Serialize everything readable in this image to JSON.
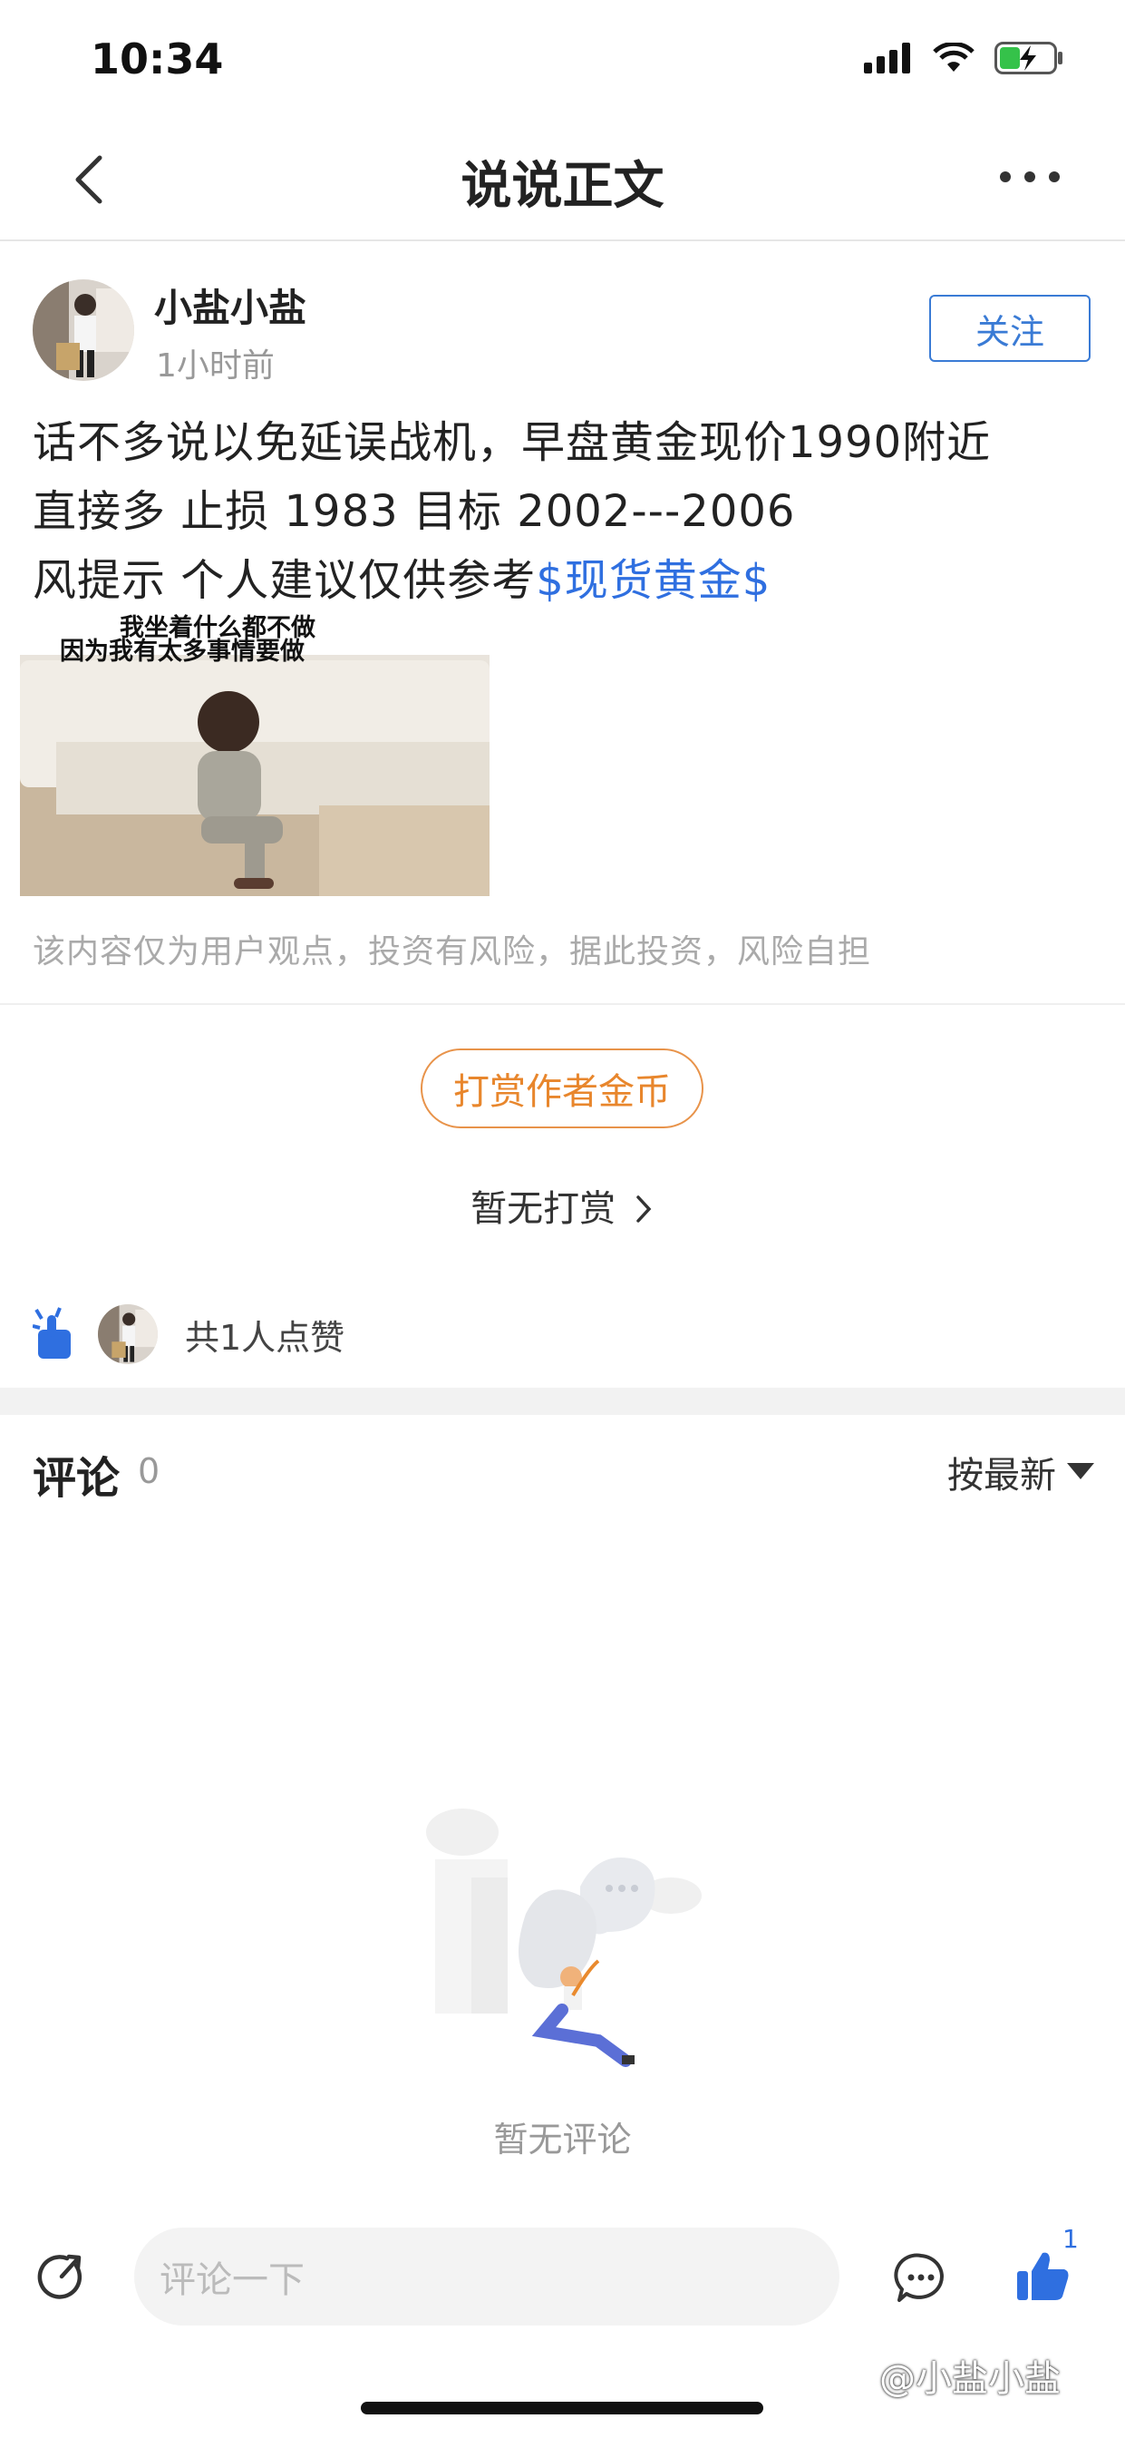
{
  "status": {
    "time": "10:34"
  },
  "nav": {
    "title": "说说正文",
    "back_icon": "chevron-left-icon",
    "more_icon": "more-dots-icon"
  },
  "author": {
    "name": "小盐小盐",
    "time": "1小时前",
    "follow_label": "关注"
  },
  "post": {
    "line1": "话不多说以免延误战机，早盘黄金现价1990附近",
    "line2": "直接多 止损 1983 目标 2002---2006",
    "line3_prefix": "风提示 个人建议仅供参考",
    "tag": "$现货黄金$",
    "image_caption_1": "我坐着什么都不做",
    "image_caption_2": "因为我有太多事情要做"
  },
  "disclaimer": "该内容仅为用户观点，投资有风险，据此投资，风险自担",
  "reward": {
    "button_label": "打赏作者金币",
    "info": "暂无打赏"
  },
  "likes": {
    "text": "共1人点赞"
  },
  "comments": {
    "title": "评论",
    "count": "0",
    "sort_label": "按最新",
    "empty_text": "暂无评论"
  },
  "bottom_bar": {
    "input_placeholder": "评论一下",
    "like_count": "1"
  },
  "watermark": "@小盐小盐",
  "colors": {
    "accent": "#2f6fe0",
    "reward": "#e8862c"
  }
}
